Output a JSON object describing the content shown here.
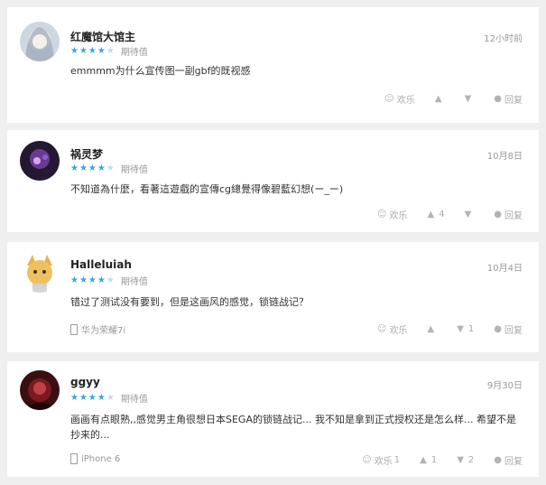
{
  "comments": [
    {
      "username": "红魔馆大馆主",
      "time": "12小时前",
      "rating_label": "期待值",
      "stars_filled": 4,
      "stars_total": 5,
      "content": "emmmm为什么宣传图一副gbf的既视感",
      "device": "",
      "actions": {
        "fun": "欢乐",
        "like_count": "",
        "dislike_count": "",
        "reply": "回复"
      }
    },
    {
      "username": "祸灵梦",
      "time": "10月8日",
      "rating_label": "期待值",
      "stars_filled": 4,
      "stars_total": 5,
      "content": "不知道為什麼，看著這遊戲的宣傳cg總覺得像碧藍幻想(ー_ー)",
      "device": "",
      "actions": {
        "fun": "欢乐",
        "like_count": "4",
        "dislike_count": "",
        "reply": "回复"
      }
    },
    {
      "username": "Halleluiah",
      "time": "10月4日",
      "rating_label": "期待值",
      "stars_filled": 4,
      "stars_total": 5,
      "content": "错过了测试没有要到，但是这画风的感觉，锁链战记？",
      "device": "华为荣耀7i",
      "actions": {
        "fun": "欢乐",
        "like_count": "",
        "dislike_count": "1",
        "reply": "回复"
      }
    },
    {
      "username": "ggyy",
      "time": "9月30日",
      "rating_label": "期待值",
      "stars_filled": 4,
      "stars_total": 5,
      "content": "画画有点眼熟,,感觉男主角很想日本SEGA的锁链战记... 我不知是拿到正式授权还是怎么样... 希望不是抄来的...",
      "device": "iPhone 6",
      "actions": {
        "fun": "欢乐",
        "fun_count": "1",
        "like_count": "1",
        "dislike_count": "2",
        "reply": "回复"
      }
    }
  ],
  "colors": {
    "star": "#39a8d6",
    "background": "#efefef",
    "card": "#ffffff",
    "muted": "#999999"
  },
  "icons": {
    "fun": "smile-icon",
    "like": "thumb-up-icon",
    "dislike": "thumb-down-icon",
    "reply": "chat-bubble-icon",
    "device": "phone-icon"
  }
}
